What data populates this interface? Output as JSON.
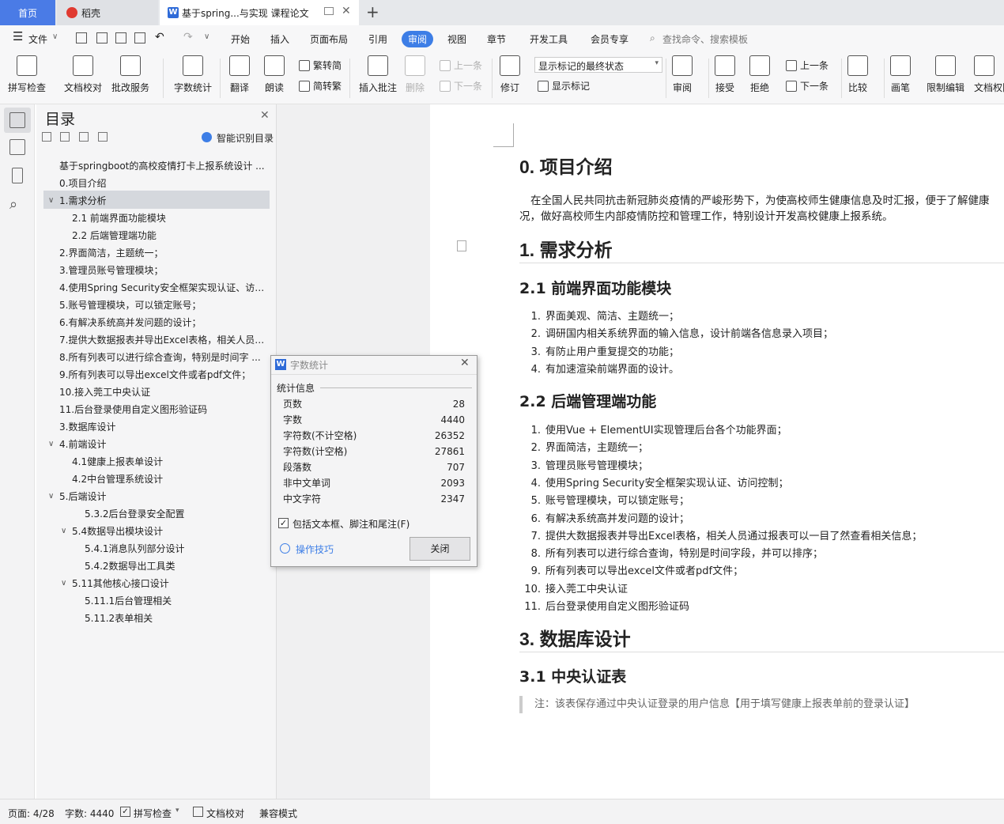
{
  "tabs": {
    "home": "首页",
    "daoke": "稻壳",
    "doc": "基于spring...与实现 课程论文"
  },
  "menu": {
    "file": "文件",
    "items": [
      "开始",
      "插入",
      "页面布局",
      "引用",
      "审阅",
      "视图",
      "章节",
      "开发工具",
      "会员专享"
    ],
    "search": "查找命令、搜索模板"
  },
  "ribbon": {
    "spell": "拼写检查",
    "proof": "文档校对",
    "batch": "批改服务",
    "wordcount": "字数统计",
    "translate": "翻译",
    "read": "朗读",
    "trad": "繁转简",
    "simp": "简转繁",
    "insert_comment": "插入批注",
    "delete": "删除",
    "prev": "上一条",
    "next": "下一条",
    "revise": "修订",
    "display_state": "显示标记的最终状态",
    "show_marks": "显示标记",
    "review": "审阅",
    "accept": "接受",
    "reject": "拒绝",
    "prev2": "上一条",
    "next2": "下一条",
    "compare": "比较",
    "pen": "画笔",
    "restrict": "限制编辑",
    "rights": "文档权限"
  },
  "toc": {
    "title": "目录",
    "smart": "智能识别目录",
    "items": [
      {
        "t": "基于springboot的高校疫情打卡上报系统设计 ..."
      },
      {
        "t": "0.项目介绍"
      },
      {
        "t": "1.需求分析"
      },
      {
        "t": "2.1 前端界面功能模块"
      },
      {
        "t": "2.2 后端管理端功能"
      },
      {
        "t": "2.界面简洁，主题统一；"
      },
      {
        "t": "3.管理员账号管理模块；"
      },
      {
        "t": "4.使用Spring Security安全框架实现认证、访 ..."
      },
      {
        "t": "5.账号管理模块，可以锁定账号；"
      },
      {
        "t": "6.有解决系统高并发问题的设计；"
      },
      {
        "t": "7.提供大数据报表并导出Excel表格，相关人员 ..."
      },
      {
        "t": "8.所有列表可以进行综合查询，特别是时间字 ..."
      },
      {
        "t": "9.所有列表可以导出excel文件或者pdf文件；"
      },
      {
        "t": "10.接入莞工中央认证"
      },
      {
        "t": "11.后台登录使用自定义图形验证码"
      },
      {
        "t": "3.数据库设计"
      },
      {
        "t": "4.前端设计"
      },
      {
        "t": "4.1健康上报表单设计"
      },
      {
        "t": "4.2中台管理系统设计"
      },
      {
        "t": "5.后端设计"
      },
      {
        "t": "5.3.2后台登录安全配置"
      },
      {
        "t": "5.4数据导出模块设计"
      },
      {
        "t": "5.4.1消息队列部分设计"
      },
      {
        "t": "5.4.2数据导出工具类"
      },
      {
        "t": "5.11其他核心接口设计"
      },
      {
        "t": "5.11.1后台管理相关"
      },
      {
        "t": "5.11.2表单相关"
      }
    ]
  },
  "doc": {
    "h0": "0. 项目介绍",
    "p0a": "在全国人民共同抗击新冠肺炎疫情的严峻形势下，为使高校师生健康信息及时汇报，便于了解健康",
    "p0b": "况，做好高校师生内部疫情防控和管理工作，特别设计开发高校健康上报系统。",
    "h1": "1. 需求分析",
    "h21": "2.1 前端界面功能模块",
    "list1": [
      "界面美观、简洁、主题统一；",
      "调研国内相关系统界面的输入信息，设计前端各信息录入项目；",
      "有防止用户重复提交的功能；",
      "有加速渲染前端界面的设计。"
    ],
    "h22": "2.2 后端管理端功能",
    "list2": [
      "使用Vue + ElementUI实现管理后台各个功能界面；",
      "界面简洁，主题统一；",
      "管理员账号管理模块；",
      "使用Spring Security安全框架实现认证、访问控制；",
      "账号管理模块，可以锁定账号；",
      "有解决系统高并发问题的设计；",
      "提供大数据报表并导出Excel表格，相关人员通过报表可以一目了然查看相关信息；",
      "所有列表可以进行综合查询，特别是时间字段，并可以排序；",
      "所有列表可以导出excel文件或者pdf文件；",
      "接入莞工中央认证",
      "后台登录使用自定义图形验证码"
    ],
    "h3": "3. 数据库设计",
    "h31": "3.1 中央认证表",
    "note": "注：该表保存通过中央认证登录的用户信息【用于填写健康上报表单前的登录认证】"
  },
  "dialog": {
    "title": "字数统计",
    "section": "统计信息",
    "rows": [
      {
        "k": "页数",
        "v": "28"
      },
      {
        "k": "字数",
        "v": "4440"
      },
      {
        "k": "字符数(不计空格)",
        "v": "26352"
      },
      {
        "k": "字符数(计空格)",
        "v": "27861"
      },
      {
        "k": "段落数",
        "v": "707"
      },
      {
        "k": "非中文单词",
        "v": "2093"
      },
      {
        "k": "中文字符",
        "v": "2347"
      }
    ],
    "include": "包括文本框、脚注和尾注(F)",
    "tips": "操作技巧",
    "close": "关闭"
  },
  "status": {
    "page": "页面: 4/28",
    "words": "字数: 4440",
    "spell": "拼写检查",
    "proof": "文档校对",
    "compat": "兼容模式"
  }
}
